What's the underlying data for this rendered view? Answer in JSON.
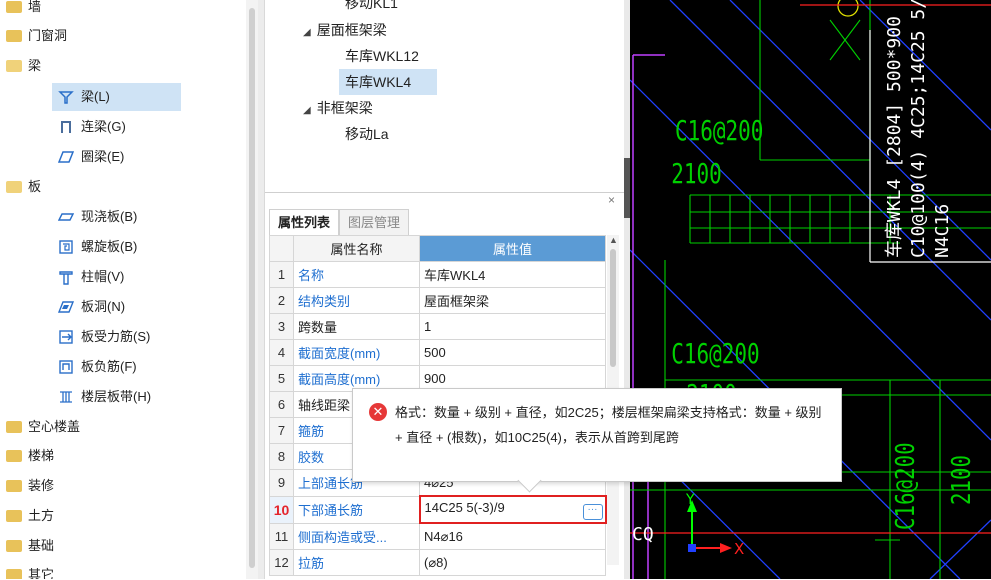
{
  "tree": {
    "items": [
      {
        "label": "墙",
        "level": 0
      },
      {
        "label": "门窗洞",
        "level": 0
      },
      {
        "label": "梁",
        "level": 0
      },
      {
        "label": "梁(L)",
        "level": 1
      },
      {
        "label": "连梁(G)",
        "level": 1
      },
      {
        "label": "圈梁(E)",
        "level": 1
      },
      {
        "label": "板",
        "level": 0
      },
      {
        "label": "现浇板(B)",
        "level": 1
      },
      {
        "label": "螺旋板(B)",
        "level": 1
      },
      {
        "label": "柱帽(V)",
        "level": 1
      },
      {
        "label": "板洞(N)",
        "level": 1
      },
      {
        "label": "板受力筋(S)",
        "level": 1
      },
      {
        "label": "板负筋(F)",
        "level": 1
      },
      {
        "label": "楼层板带(H)",
        "level": 1
      },
      {
        "label": "空心楼盖",
        "level": 0
      },
      {
        "label": "楼梯",
        "level": 0
      },
      {
        "label": "装修",
        "level": 0
      },
      {
        "label": "土方",
        "level": 0
      },
      {
        "label": "基础",
        "level": 0
      },
      {
        "label": "其它",
        "level": 0
      }
    ]
  },
  "components": {
    "items": [
      {
        "label": "移动KL1",
        "type": "leaf"
      },
      {
        "label": "屋面框架梁",
        "type": "group"
      },
      {
        "label": "车库WKL12",
        "type": "leaf"
      },
      {
        "label": "车库WKL4",
        "type": "leaf"
      },
      {
        "label": "非框架梁",
        "type": "group"
      },
      {
        "label": "移动La",
        "type": "leaf"
      }
    ]
  },
  "properties": {
    "close": "×",
    "tabs": [
      "属性列表",
      "图层管理"
    ],
    "header_name": "属性名称",
    "header_value": "属性值",
    "rows": [
      {
        "num": "1",
        "name": "名称",
        "value": "车库WKL4",
        "blue": true
      },
      {
        "num": "2",
        "name": "结构类别",
        "value": "屋面框架梁",
        "blue": true
      },
      {
        "num": "3",
        "name": "跨数量",
        "value": "1",
        "blue": false
      },
      {
        "num": "4",
        "name": "截面宽度(mm)",
        "value": "500",
        "blue": true
      },
      {
        "num": "5",
        "name": "截面高度(mm)",
        "value": "900",
        "blue": true
      },
      {
        "num": "6",
        "name": "轴线距梁",
        "value": "",
        "blue": false
      },
      {
        "num": "7",
        "name": "箍筋",
        "value": "",
        "blue": true
      },
      {
        "num": "8",
        "name": "胶数",
        "value": "",
        "blue": true
      },
      {
        "num": "9",
        "name": "上部通长筋",
        "value": "4⌀25",
        "blue": true
      },
      {
        "num": "10",
        "name": "下部通长筋",
        "value": "14C25 5(-3)/9",
        "blue": true
      },
      {
        "num": "11",
        "name": "侧面构造或受...",
        "value": "N4⌀16",
        "blue": true
      },
      {
        "num": "12",
        "name": "拉筋",
        "value": "(⌀8)",
        "blue": true
      }
    ],
    "more_button": "···"
  },
  "tooltip": {
    "icon": "✕",
    "message": "格式：数量 + 级别 + 直径，如2C25；楼层框架扁梁支持格式：数量 + 级别 + 直径 + (根数)，如10C25(4)，表示从首跨到尾跨"
  },
  "cad": {
    "labels": {
      "rebar_top": "C16@200",
      "dim_top": "2100",
      "rebar_mid": "C16@200",
      "dim_mid": "2100",
      "rebar_vertical": "C16@200",
      "dim_vertical": "2100",
      "beam_line1": "车库WKL4 [2804] 500*900",
      "beam_line2": "C10@100(4) 4C25;14C25 5/",
      "beam_line3": "N4C16",
      "axis_x": "X",
      "axis_y": "Y",
      "cq": "CQ"
    },
    "colors": {
      "green": "#00d000",
      "white": "#ffffff",
      "blue": "#2040ff",
      "red": "#ff2020",
      "yellow": "#e0e000",
      "purple": "#c040ff"
    }
  }
}
